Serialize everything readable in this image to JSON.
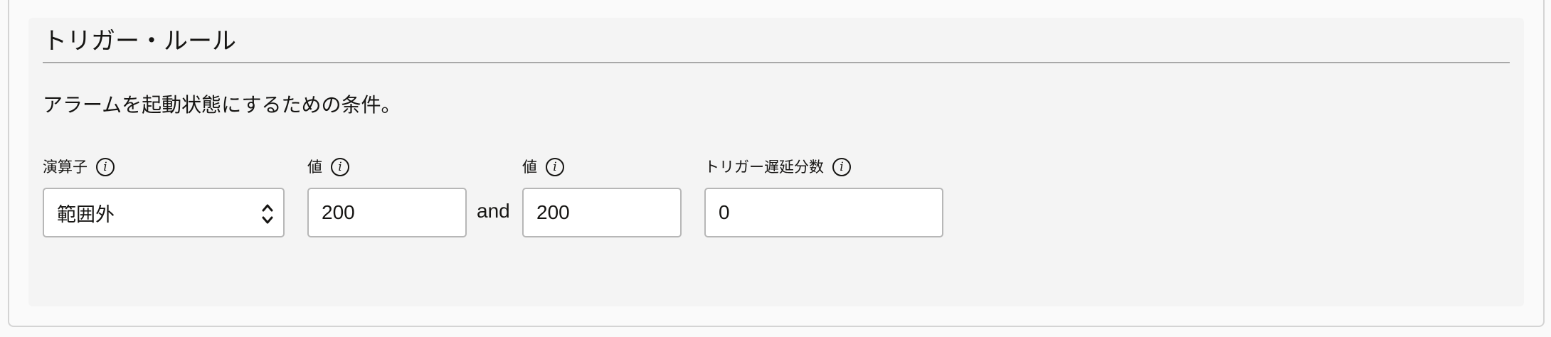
{
  "section": {
    "title": "トリガー・ルール",
    "description": "アラームを起動状態にするための条件。"
  },
  "fields": {
    "operator": {
      "label": "演算子",
      "value": "範囲外",
      "info_icon": "info-icon"
    },
    "value1": {
      "label": "値",
      "value": "200",
      "info_icon": "info-icon"
    },
    "connector": "and",
    "value2": {
      "label": "値",
      "value": "200",
      "info_icon": "info-icon"
    },
    "trigger_delay": {
      "label": "トリガー遅延分数",
      "value": "0",
      "info_icon": "info-icon"
    }
  },
  "info_glyph": "i",
  "colors": {
    "panel_bg": "#f4f4f4",
    "page_bg": "#fafafa",
    "text": "#161513",
    "input_border": "#b7b7b7",
    "rule": "#a8a8a8"
  }
}
